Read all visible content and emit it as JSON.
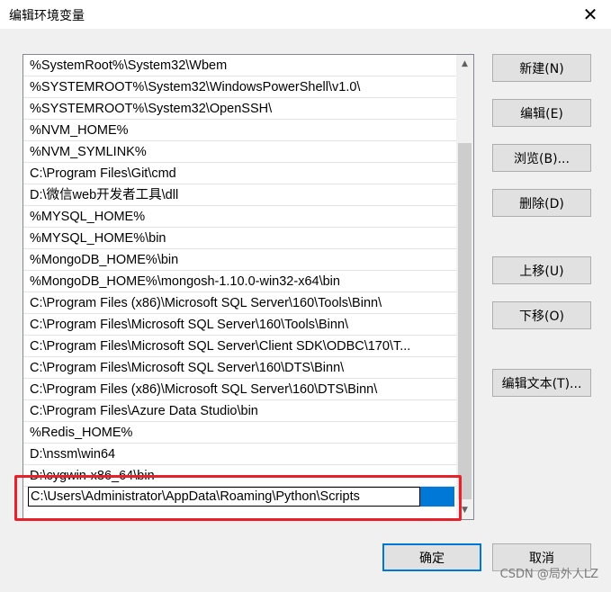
{
  "window": {
    "title": "编辑环境变量",
    "close_glyph": "✕"
  },
  "path_list": {
    "entries": [
      "%SystemRoot%\\System32\\Wbem",
      "%SYSTEMROOT%\\System32\\WindowsPowerShell\\v1.0\\",
      "%SYSTEMROOT%\\System32\\OpenSSH\\",
      "%NVM_HOME%",
      "%NVM_SYMLINK%",
      "C:\\Program Files\\Git\\cmd",
      "D:\\微信web开发者工具\\dll",
      "%MYSQL_HOME%",
      "%MYSQL_HOME%\\bin",
      "%MongoDB_HOME%\\bin",
      "%MongoDB_HOME%\\mongosh-1.10.0-win32-x64\\bin",
      "C:\\Program Files (x86)\\Microsoft SQL Server\\160\\Tools\\Binn\\",
      "C:\\Program Files\\Microsoft SQL Server\\160\\Tools\\Binn\\",
      "C:\\Program Files\\Microsoft SQL Server\\Client SDK\\ODBC\\170\\T...",
      "C:\\Program Files\\Microsoft SQL Server\\160\\DTS\\Binn\\",
      "C:\\Program Files (x86)\\Microsoft SQL Server\\160\\DTS\\Binn\\",
      "C:\\Program Files\\Azure Data Studio\\bin",
      "%Redis_HOME%",
      "D:\\nssm\\win64",
      "D:\\cygwin-x86_64\\bin"
    ],
    "editing_value": "C:\\Users\\Administrator\\AppData\\Roaming\\Python\\Scripts",
    "scroll_up_glyph": "▲",
    "scroll_down_glyph": "▼"
  },
  "buttons": {
    "new": "新建(N)",
    "edit": "编辑(E)",
    "browse": "浏览(B)...",
    "delete": "删除(D)",
    "move_up": "上移(U)",
    "move_down": "下移(O)",
    "edit_text": "编辑文本(T)...",
    "ok": "确定",
    "cancel": "取消"
  },
  "watermark": "CSDN @局外人LZ",
  "colors": {
    "selection": "#0078d7",
    "highlight_border": "#e8202a"
  }
}
